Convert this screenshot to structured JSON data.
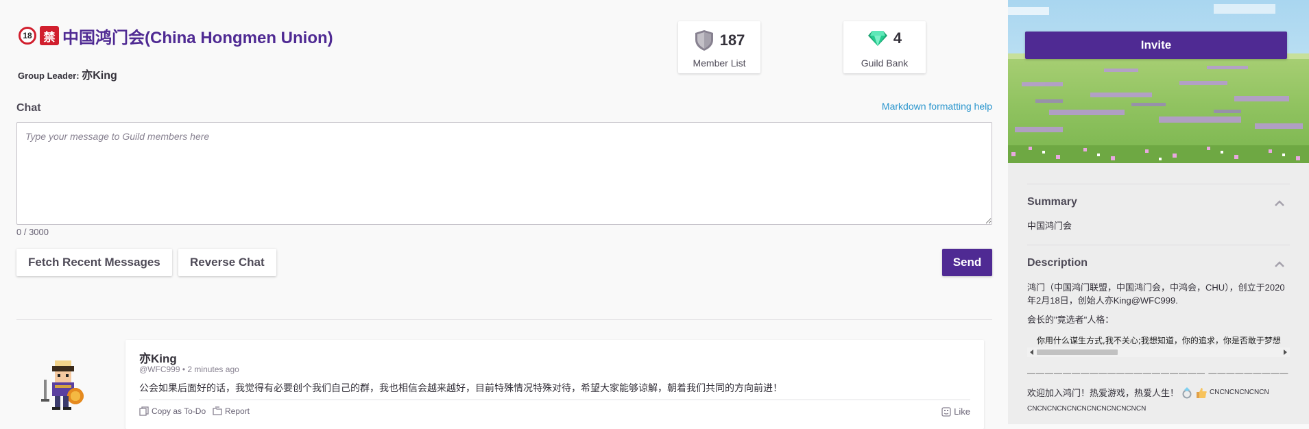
{
  "guild": {
    "badge_18": "18",
    "badge_ban": "禁",
    "name": "中国鸿门会(China Hongmen Union)",
    "leader_label": "Group Leader: ",
    "leader_name": "亦King"
  },
  "stats": {
    "members": {
      "value": "187",
      "label": "Member List",
      "icon": "shield-icon"
    },
    "bank": {
      "value": "4",
      "label": "Guild Bank",
      "icon": "gem-icon"
    }
  },
  "chat": {
    "label": "Chat",
    "markdown_help": "Markdown formatting help",
    "placeholder": "Type your message to Guild members here",
    "counter": "0 / 3000",
    "fetch_label": "Fetch Recent Messages",
    "reverse_label": "Reverse Chat",
    "send_label": "Send"
  },
  "messages": [
    {
      "author": "亦King",
      "handle": "@WFC999",
      "time": "2 minutes ago",
      "text": "公会如果后面好的话，我觉得有必要创个我们自己的群，我也相信会越来越好，目前特殊情况特殊对待，希望大家能够谅解，朝着我们共同的方向前进！",
      "copy_label": "Copy as To-Do",
      "report_label": "Report",
      "like_label": "Like"
    }
  ],
  "sidebar": {
    "invite_label": "Invite",
    "summary": {
      "title": "Summary",
      "text": "中国鸿门会"
    },
    "description": {
      "title": "Description",
      "para1": "鸿门（中国鸿门联盟，中国鸿门会，中鸿会，CHU），创立于2020年2月18日，创始人亦King@WFC999.",
      "para2": "会长的\"竟选者\"人格：",
      "code": "你用什么谋生方式,我不关心;我想知道，你的追求，你是否敢于梦想",
      "dashes": "———————————————————— —————————",
      "welcome": "欢迎加入鸿门！热爱游戏，热爱人生！",
      "welcome_tail": "CNCNCNCNCNCN",
      "cn_line": "CNCNCNCNCNCNCNCNCNCNCNCN"
    }
  },
  "colors": {
    "brand": "#4f2a93",
    "link": "#2995cd",
    "badge_red": "#d11f2e",
    "gem": "#24cc8f"
  }
}
